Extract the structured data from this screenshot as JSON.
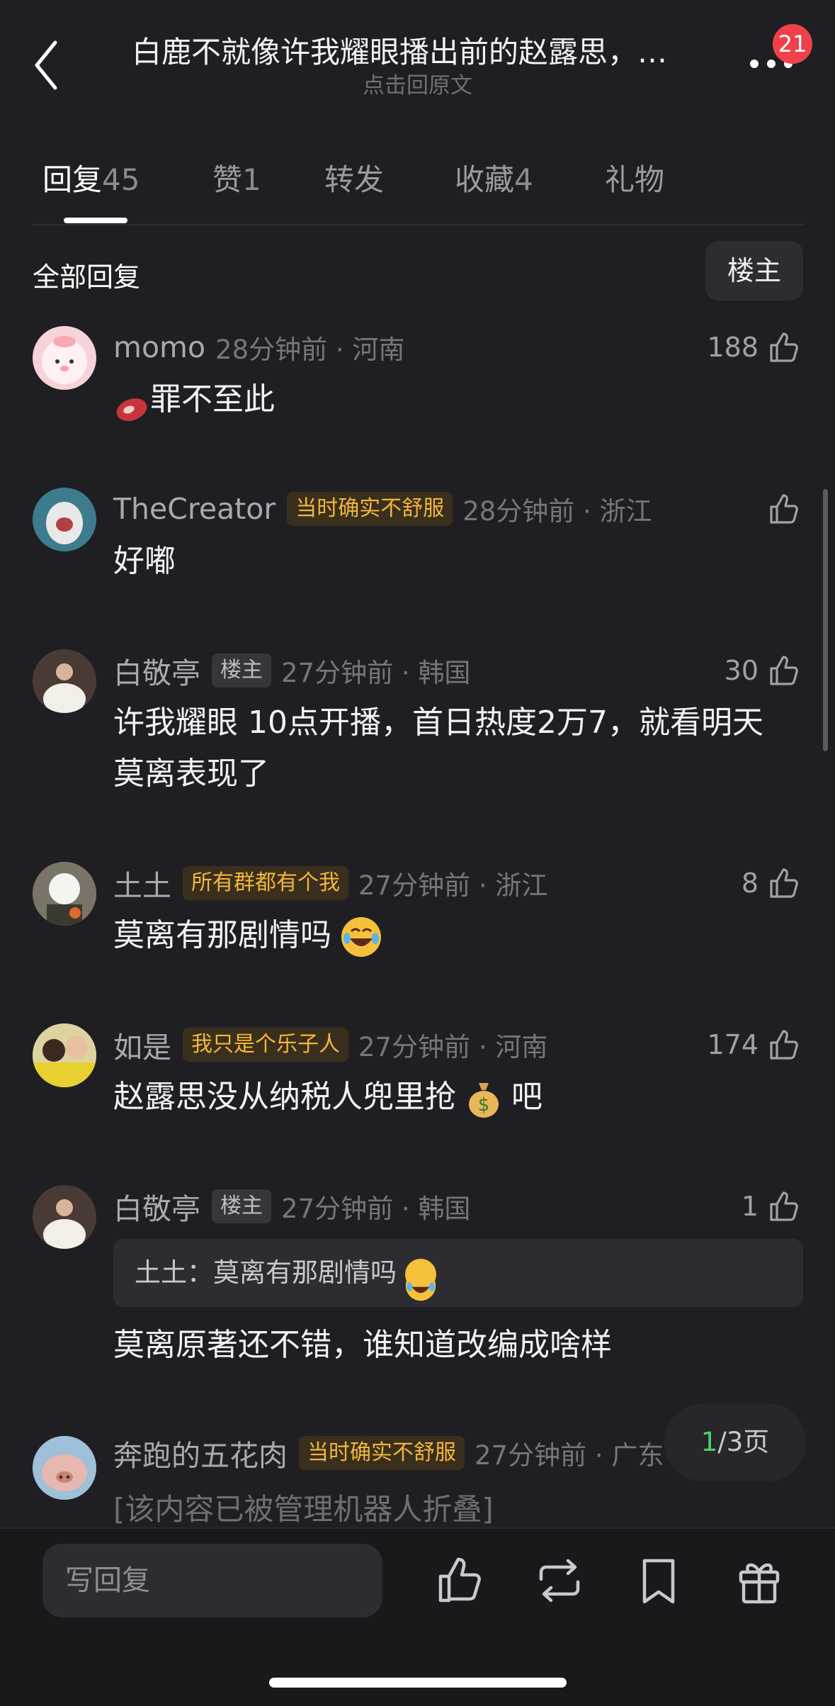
{
  "header": {
    "title": "白鹿不就像许我耀眼播出前的赵露思，…",
    "subtitle": "点击回原文",
    "badge": "21"
  },
  "tabs": [
    {
      "label": "回复",
      "count": "45"
    },
    {
      "label": "赞",
      "count": "1"
    },
    {
      "label": "转发",
      "count": ""
    },
    {
      "label": "收藏",
      "count": "4"
    },
    {
      "label": "礼物",
      "count": ""
    }
  ],
  "section": {
    "title": "全部回复",
    "filter": "楼主"
  },
  "comments": [
    {
      "user": "momo",
      "tag": "",
      "time": "28分钟前 · 河南",
      "likes": "188",
      "text": "罪不至此"
    },
    {
      "user": "TheCreator",
      "tag": "当时确实不舒服",
      "time": "28分钟前 · 浙江",
      "likes": "",
      "text": "好嘟"
    },
    {
      "user": "白敬亭",
      "tag": "楼主",
      "time": "27分钟前 · 韩国",
      "likes": "30",
      "text": "许我耀眼 10点开播，首日热度2万7，就看明天莫离表现了"
    },
    {
      "user": "土土",
      "tag": "所有群都有个我",
      "time": "27分钟前 · 浙江",
      "likes": "8",
      "text": "莫离有那剧情吗"
    },
    {
      "user": "如是",
      "tag": "我只是个乐子人",
      "time": "27分钟前 · 河南",
      "likes": "174",
      "text_a": "赵露思没从纳税人兜里抢",
      "text_b": "吧"
    },
    {
      "user": "白敬亭",
      "tag": "楼主",
      "time": "27分钟前 · 韩国",
      "likes": "1",
      "quote": "土土：莫离有那剧情吗",
      "text": "莫离原著还不错，谁知道改编成啥样"
    },
    {
      "user": "奔跑的五花肉",
      "tag": "当时确实不舒服",
      "time": "27分钟前 · 广东",
      "likes": "",
      "text": "[该内容已被管理机器人折叠]"
    }
  ],
  "pager": {
    "current": "1",
    "total": "/3页"
  },
  "bottom": {
    "reply_placeholder": "写回复"
  },
  "colors": {
    "background": "#1f1f23",
    "gold_tag": "#f2b63b",
    "badge": "#f0414a",
    "pager_current": "#4fd16a"
  }
}
